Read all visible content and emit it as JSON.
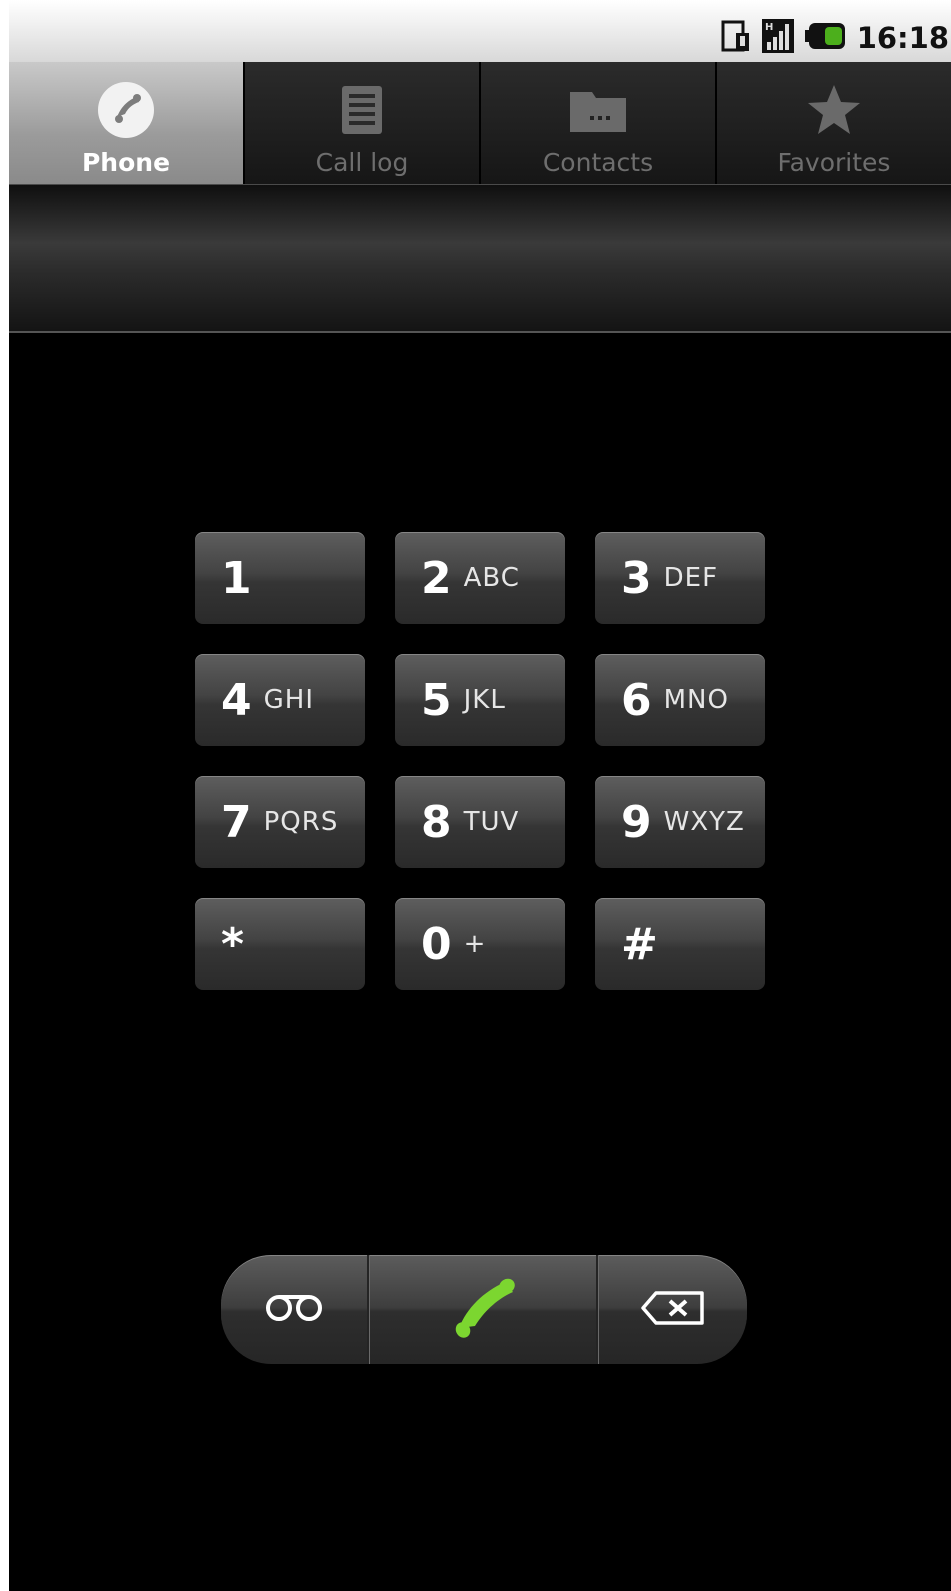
{
  "status_bar": {
    "time": "16:18",
    "icons": [
      "sim-card-icon",
      "signal-icon",
      "battery-icon"
    ],
    "battery_color": "#4caf1c"
  },
  "tabs": [
    {
      "label": "Phone",
      "icon": "phone-icon",
      "active": true
    },
    {
      "label": "Call log",
      "icon": "call-log-icon",
      "active": false
    },
    {
      "label": "Contacts",
      "icon": "contacts-icon",
      "active": false
    },
    {
      "label": "Favorites",
      "icon": "star-icon",
      "active": false
    }
  ],
  "dialer": {
    "entered_digits": ""
  },
  "keypad": {
    "keys": [
      {
        "digit": "1",
        "letters": ""
      },
      {
        "digit": "2",
        "letters": "ABC"
      },
      {
        "digit": "3",
        "letters": "DEF"
      },
      {
        "digit": "4",
        "letters": "GHI"
      },
      {
        "digit": "5",
        "letters": "JKL"
      },
      {
        "digit": "6",
        "letters": "MNO"
      },
      {
        "digit": "7",
        "letters": "PQRS"
      },
      {
        "digit": "8",
        "letters": "TUV"
      },
      {
        "digit": "9",
        "letters": "WXYZ"
      },
      {
        "digit": "*",
        "letters": ""
      },
      {
        "digit": "0",
        "letters": "+"
      },
      {
        "digit": "#",
        "letters": ""
      }
    ]
  },
  "actions": {
    "voicemail_icon": "voicemail-icon",
    "call_icon": "call-icon",
    "call_color": "#7cd630",
    "delete_icon": "backspace-icon"
  }
}
